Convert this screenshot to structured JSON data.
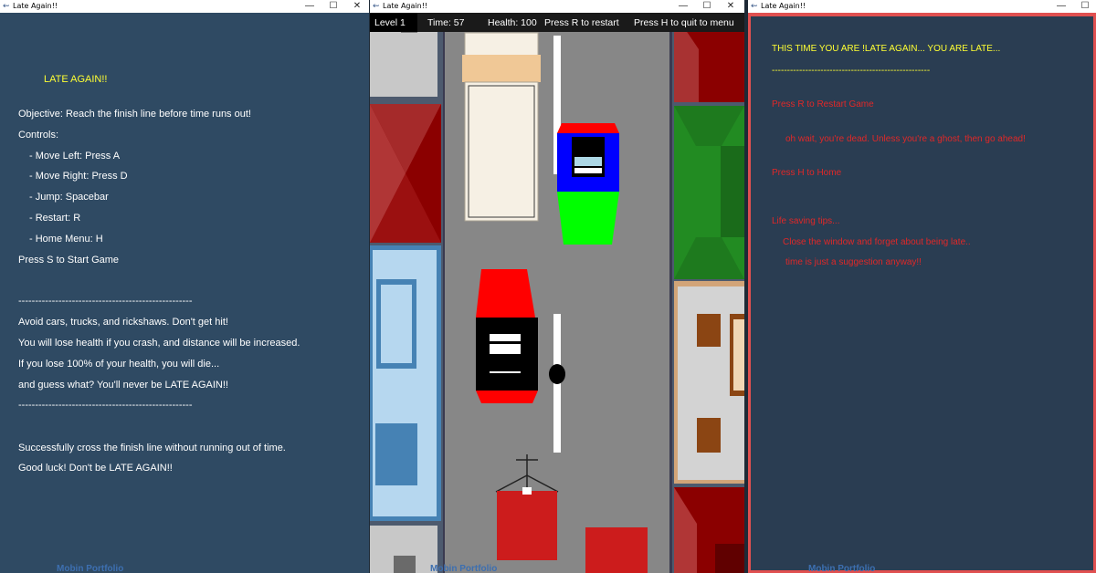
{
  "window_title": "Late Again!!",
  "left": {
    "heading": "LATE AGAIN!!",
    "objective": "Objective: Reach the finish line before time runs out!",
    "controls_label": "Controls:",
    "controls": [
      "- Move Left: Press A",
      "- Move Right: Press D",
      "- Jump: Spacebar",
      "- Restart: R",
      "- Home Menu: H"
    ],
    "start_hint": "Press S to Start Game",
    "divider": "----------------------------------------------------",
    "warnings": [
      "Avoid cars, trucks, and rickshaws. Don't get hit!",
      "You will lose health if you crash, and distance will be increased.",
      "If you lose 100% of your health, you will die...",
      "and guess what? You'll never be LATE AGAIN!!"
    ],
    "closing": [
      "Successfully cross the finish line without running out of time.",
      "Good luck! Don't be LATE AGAIN!!"
    ]
  },
  "game": {
    "hud": {
      "level": "Level 1",
      "time": "Time: 57",
      "health": "Health: 100",
      "restart": "Press R to restart",
      "quit": "Press H to quit to menu"
    },
    "colors": {
      "road": "#878787",
      "lane_line": "#ffffff",
      "red_car": "#ff0000",
      "blue_car": "#0000ff",
      "green_car": "#00ff00",
      "truck_cab": "#f0c896",
      "truck_body": "#f6f0e4",
      "rickshaw": "#cc1c1c",
      "roof_dark_red": "#8b0000",
      "roof_green": "#228b22",
      "house_light_blue": "#b6d7ef",
      "house_blue_window": "#4682b4",
      "house_tan": "#d2a478",
      "window_brown": "#8b4513"
    },
    "player": {
      "icon": "player-dot"
    }
  },
  "right": {
    "headline": "THIS TIME YOU ARE !LATE AGAIN... YOU ARE LATE...",
    "divider": "----------------------------------------------------",
    "restart": "Press  R to Restart Game",
    "dead_msg": "oh wait, you're dead. Unless you're a ghost, then go ahead!",
    "home": "Press H to Home",
    "tips_title": "Life saving tips...",
    "tips": [
      "Close the window and forget about being late..",
      "time is just a suggestion anyway!!"
    ]
  },
  "taskbar_peek": "Mobin Portfolio"
}
